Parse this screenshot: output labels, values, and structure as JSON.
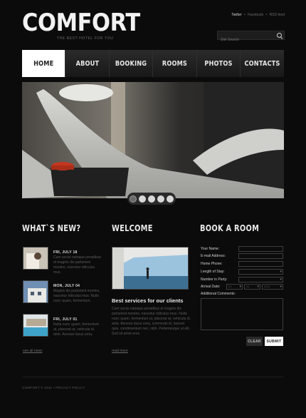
{
  "header": {
    "logo": "COMFORT",
    "tagline": "THE BEST HOTEL FOR YOU",
    "social": [
      "Twitter",
      "Facebook",
      "RSS feed"
    ],
    "search_placeholder": "Site Search"
  },
  "nav": {
    "items": [
      {
        "label": "HOME",
        "active": true
      },
      {
        "label": "ABOUT",
        "active": false
      },
      {
        "label": "BOOKING",
        "active": false
      },
      {
        "label": "ROOMS",
        "active": false
      },
      {
        "label": "PHOTOS",
        "active": false
      },
      {
        "label": "CONTACTS",
        "active": false
      }
    ]
  },
  "slider": {
    "count": 5,
    "active_index": 0
  },
  "news": {
    "title": "WHAT`S NEW?",
    "items": [
      {
        "date": "FRI, JULY 18",
        "text": "Cum sociis natoque penatibus et magnis dis parturient montes, nascetur ridiculus mus."
      },
      {
        "date": "MON, JULY 04",
        "text": "Magnis dis parturient montes, nascetur ridiculus mus. Nulla nunc quam, fermentum."
      },
      {
        "date": "FRI, JULY 01",
        "text": "Nulla nunc quam, fermentum ut, placerat at, vehicula id, ante. Aenean lacus urna."
      }
    ],
    "more": "see all news"
  },
  "welcome": {
    "title": "WELCOME",
    "subtitle": "Best services for our clients",
    "body": "Cum sociis natoque penatibus et magnis dis parturient montes, nascetur ridiculus mus. Nulla nunc quam, fermentum ut, placerat at, vehicula id, ante. Aenean lacus urna, commodo id, laoreet quis, condimentum nec, nibh. Pellentesque ut elit. Sed sit amet eros.",
    "more": "read more"
  },
  "booking": {
    "title": "BOOK A ROOM",
    "fields": [
      "Your Name:",
      "E-mail Address:",
      "Home Phone:"
    ],
    "length_label": "Length of Stay:",
    "party_label": "Number in Party:",
    "arrival_label": "Arrival Date:",
    "arrival_values": [
      "01",
      "01",
      "2011"
    ],
    "comments_label": "Additional Comments:",
    "clear": "CLEAR",
    "submit": "SUBMIT"
  },
  "footer": {
    "text": "COMFORT © 2011 • PRIVACY POLICY"
  }
}
